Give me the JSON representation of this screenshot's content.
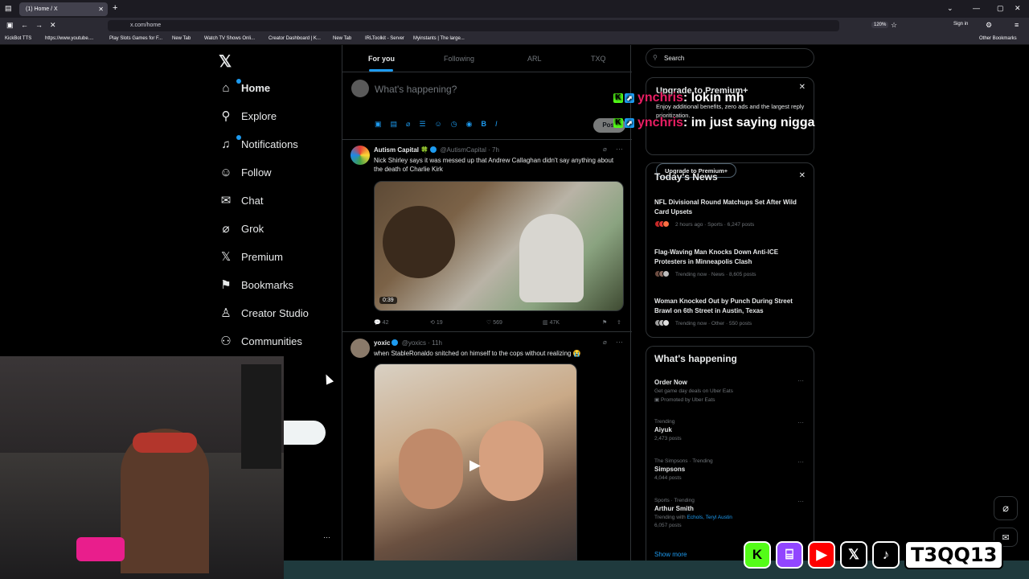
{
  "browser": {
    "tab_title": "(1) Home / X",
    "url": "x.com/home",
    "zoom": "120%",
    "sign_in": "Sign in",
    "bookmarks": [
      "KickBot TTS",
      "https://www.youtube....",
      "Play Slots Games for F...",
      "New Tab",
      "Watch TV Shows Onli...",
      "Creator Dashboard | K...",
      "New Tab",
      "IRLToolkit - Server",
      "Myinstants | The large..."
    ],
    "other_bookmarks": "Other Bookmarks"
  },
  "nav": {
    "items": [
      {
        "label": "Home",
        "icon": "home-icon",
        "glyph": "⌂"
      },
      {
        "label": "Explore",
        "icon": "search-icon",
        "glyph": "⚲"
      },
      {
        "label": "Notifications",
        "icon": "bell-icon",
        "glyph": "🔔"
      },
      {
        "label": "Follow",
        "icon": "add-user-icon",
        "glyph": "👤"
      },
      {
        "label": "Chat",
        "icon": "mail-icon",
        "glyph": "✉"
      },
      {
        "label": "Grok",
        "icon": "grok-icon",
        "glyph": "⌀"
      },
      {
        "label": "Premium",
        "icon": "x-icon",
        "glyph": "𝕏"
      },
      {
        "label": "Bookmarks",
        "icon": "bookmark-icon",
        "glyph": "🔖"
      },
      {
        "label": "Creator Studio",
        "icon": "creator-icon",
        "glyph": "♙"
      },
      {
        "label": "Communities",
        "icon": "communities-icon",
        "glyph": "👥"
      }
    ],
    "more_dots": "···"
  },
  "feed": {
    "tabs": [
      "For you",
      "Following",
      "ARL",
      "TXQ"
    ],
    "compose_placeholder": "What's happening?",
    "post_button": "Post",
    "tweets": [
      {
        "name": "Autism Capital 🍀",
        "handle": "@AutismCapital · 7h",
        "text": "Nick Shirley says it was messed up that Andrew Callaghan didn't say anything about the death of Charlie Kirk",
        "duration": "0:39",
        "replies": "42",
        "reposts": "19",
        "likes": "569",
        "views": "47K"
      },
      {
        "name": "yoxic",
        "handle": "@yoxics · 11h",
        "text": "when StableRonaldo snitched on himself to the cops without realizing 😭"
      }
    ]
  },
  "sidebar": {
    "search_placeholder": "Search",
    "premium": {
      "title": "Upgrade to Premium+",
      "text": "Enjoy additional benefits, zero ads and the largest reply prioritization.",
      "button": "Upgrade to Premium+"
    },
    "news": {
      "title": "Today's News",
      "items": [
        {
          "title": "NFL Divisional Round Matchups Set After Wild Card Upsets",
          "meta": "2 hours ago · Sports · 6,247 posts"
        },
        {
          "title": "Flag-Waving Man Knocks Down Anti-ICE Protesters in Minneapolis Clash",
          "meta": "Trending now · News · 8,605 posts"
        },
        {
          "title": "Woman Knocked Out by Punch During Street Brawl on 6th Street in Austin, Texas",
          "meta": "Trending now · Other · 550 posts"
        }
      ]
    },
    "happening": {
      "title": "What's happening",
      "items": [
        {
          "cat": "",
          "title": "Order Now",
          "sub": "Get game day deals on Uber Eats",
          "sub2": "Promoted by Uber Eats"
        },
        {
          "cat": "Trending",
          "title": "Aiyuk",
          "sub": "2,473 posts"
        },
        {
          "cat": "The Simpsons · Trending",
          "title": "Simpsons",
          "sub": "4,044 posts"
        },
        {
          "cat": "Sports · Trending",
          "title": "Arthur Smith",
          "sub_prefix": "Trending with",
          "sub_link": "Echols, Teryl Austin",
          "sub": "6,057 posts"
        }
      ],
      "show_more": "Show more"
    }
  },
  "overlay": {
    "chat": [
      {
        "user": "ynchris",
        "msg": " : lokin mh"
      },
      {
        "user": "ynchris",
        "msg": " : im just saying nigga"
      }
    ],
    "streamer": "T3QQ13",
    "socials": [
      "kick",
      "twitch",
      "youtube",
      "x",
      "tiktok"
    ]
  },
  "colors": {
    "accent": "#1d9bf0",
    "kick_green": "#53fc18",
    "twitch_purple": "#9146ff",
    "youtube_red": "#ff0000"
  }
}
